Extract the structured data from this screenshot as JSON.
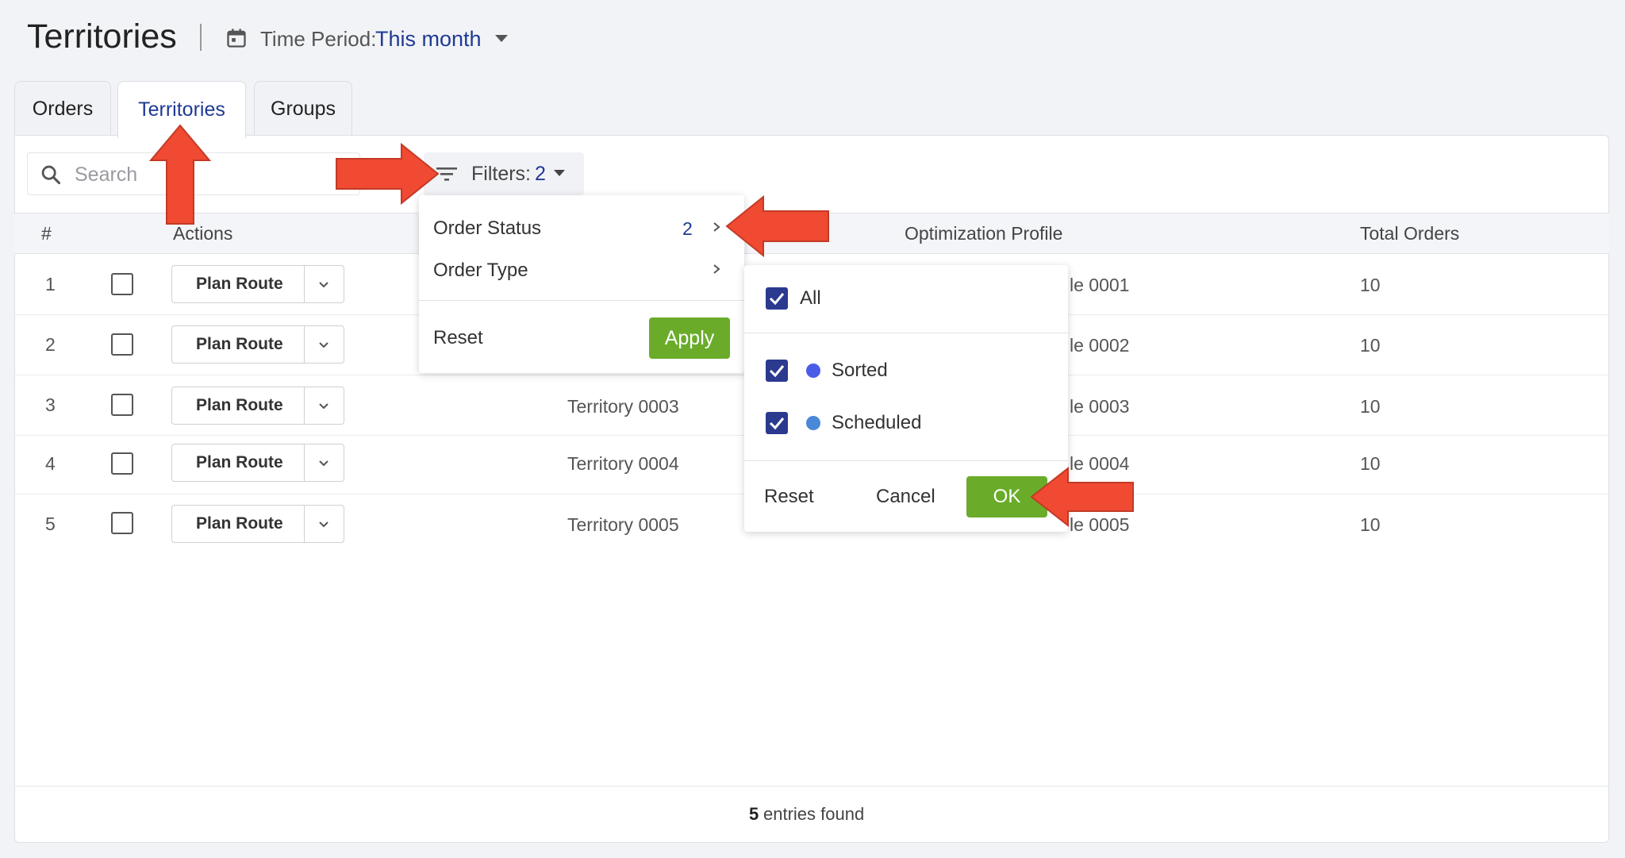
{
  "header": {
    "title": "Territories",
    "time_period_label": "Time Period:",
    "time_period_value": "This month"
  },
  "tabs": [
    {
      "label": "Orders",
      "active": false
    },
    {
      "label": "Territories",
      "active": true
    },
    {
      "label": "Groups",
      "active": false
    }
  ],
  "toolbar": {
    "search_placeholder": "Search",
    "filters_label": "Filters:",
    "filters_count": "2"
  },
  "table": {
    "headers": {
      "number": "#",
      "actions": "Actions",
      "optimization_profile": "Optimization Profile",
      "total_orders": "Total Orders"
    },
    "plan_button_label": "Plan Route",
    "rows": [
      {
        "number": "1",
        "territory": "",
        "profile_suffix": "le 0001",
        "total_orders": "10"
      },
      {
        "number": "2",
        "territory": "",
        "profile_suffix": "le 0002",
        "total_orders": "10"
      },
      {
        "number": "3",
        "territory": "Territory 0003",
        "profile_suffix": "le 0003",
        "total_orders": "10"
      },
      {
        "number": "4",
        "territory": "Territory 0004",
        "profile_suffix": "le 0004",
        "total_orders": "10"
      },
      {
        "number": "5",
        "territory": "Territory 0005",
        "profile_suffix": "le 0005",
        "total_orders": "10"
      }
    ]
  },
  "footer": {
    "count": "5",
    "text": "entries found"
  },
  "filter_menu": {
    "items": [
      {
        "label": "Order Status",
        "count": "2"
      },
      {
        "label": "Order Type",
        "count": ""
      }
    ],
    "reset_label": "Reset",
    "apply_label": "Apply"
  },
  "status_submenu": {
    "all_label": "All",
    "options": [
      {
        "label": "Sorted",
        "checked": true,
        "color": "#4a5de8"
      },
      {
        "label": "Scheduled",
        "checked": true,
        "color": "#4a88d8"
      }
    ],
    "reset_label": "Reset",
    "cancel_label": "Cancel",
    "ok_label": "OK"
  },
  "colors": {
    "accent": "#1f3a93",
    "apply_green": "#6aac2a",
    "checkbox_blue": "#2b3a8f",
    "annotation_arrow": "#f04a32"
  }
}
